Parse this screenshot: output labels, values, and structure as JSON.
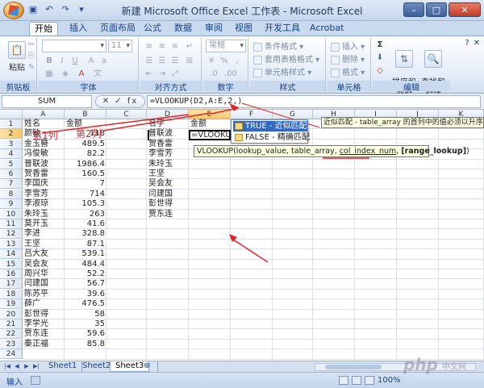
{
  "window": {
    "title": "新建 Microsoft Office Excel 工作表 - Microsoft Excel",
    "controls": [
      "–",
      "□",
      "✕"
    ]
  },
  "ribbon_tabs": [
    "开始",
    "插入",
    "页面布局",
    "公式",
    "数据",
    "审阅",
    "视图",
    "开发工具",
    "Acrobat"
  ],
  "ribbon": {
    "clipboard": {
      "label": "剪贴板",
      "paste": "粘贴"
    },
    "font": {
      "label": "字体",
      "name": "",
      "size": "11"
    },
    "alignment": {
      "label": "对齐方式"
    },
    "number": {
      "label": "数字",
      "format": "常规"
    },
    "styles": {
      "label": "样式",
      "items": [
        "条件格式",
        "套用表格格式",
        "单元格样式"
      ]
    },
    "cells": {
      "label": "单元格",
      "items": [
        "插入",
        "删除",
        "格式"
      ]
    },
    "editing": {
      "label": "编辑",
      "sort": "排序和\n筛选",
      "find": "查找和\n选择"
    }
  },
  "formula_bar": {
    "name_box": "SUM",
    "controls": "✕ ✓ fx",
    "formula": "=VLOOKUP(D2,A:E,2,)"
  },
  "columns": [
    "A",
    "B",
    "C",
    "D",
    "E",
    "F",
    "G",
    "H",
    "I",
    "J",
    "K"
  ],
  "rows": [
    "1",
    "2",
    "3",
    "4",
    "5",
    "6",
    "7",
    "8",
    "9",
    "10",
    "11",
    "12",
    "13",
    "14",
    "15",
    "16",
    "17",
    "18",
    "19",
    "20",
    "21",
    "22",
    "23",
    "24"
  ],
  "column_a": [
    "姓名",
    "颜敏",
    "金玉簪",
    "冯俊敏",
    "普联波",
    "贺香雷",
    "李国庆",
    "李雪芳",
    "李淑琼",
    "朱玲玉",
    "莫开玉",
    "李进",
    "王坚",
    "吕大友",
    "吴会友",
    "周兴华",
    "闫建国",
    "陈苏平",
    "薛广",
    "彭世得",
    "李学光",
    "贾东连",
    "秦正福"
  ],
  "column_b": [
    "金额",
    "118",
    "489.5",
    "82.2",
    "1986.4",
    "160.5",
    "7",
    "714",
    "105.3",
    "263",
    "41.6",
    "328.8",
    "87.1",
    "539.1",
    "484.4",
    "52.2",
    "56.7",
    "39.6",
    "476.5",
    "58",
    "35",
    "59.6",
    "85.8"
  ],
  "column_d": [
    "名字",
    "普联波",
    "贺香雷",
    "李雪芳",
    "朱玲玉",
    "王坚",
    "吴会友",
    "闫建国",
    "彭世得",
    "贾东连"
  ],
  "cell_e1": "金额",
  "cell_e2": "=VLOOKUP",
  "autocomplete": {
    "items": [
      {
        "label": "TRUE - 近似匹配",
        "selected": true
      },
      {
        "label": "FALSE - 精确匹配",
        "selected": false
      }
    ],
    "tooltip": "近似匹配 - table_array 的首列中的值必须以升序排序"
  },
  "function_tooltip": {
    "prefix": "VLOOKUP(lookup_value, table_array, ",
    "underlined": "col_index_num",
    "sep": ", ",
    "bold": "[range_lookup]",
    "suffix": ")"
  },
  "annotations": {
    "first_col": "第1列",
    "second_col": "第2列"
  },
  "sheet_tabs": [
    "Sheet1",
    "Sheet2",
    "Sheet3"
  ],
  "active_sheet": "Sheet3",
  "status": {
    "mode": "输入",
    "zoom": "100%"
  },
  "watermark": {
    "logo": "php",
    "site": "中文网"
  },
  "colors": {
    "accent": "#3169c6",
    "annotation": "#e0262a",
    "tooltip_bg": "#ffffe1"
  }
}
